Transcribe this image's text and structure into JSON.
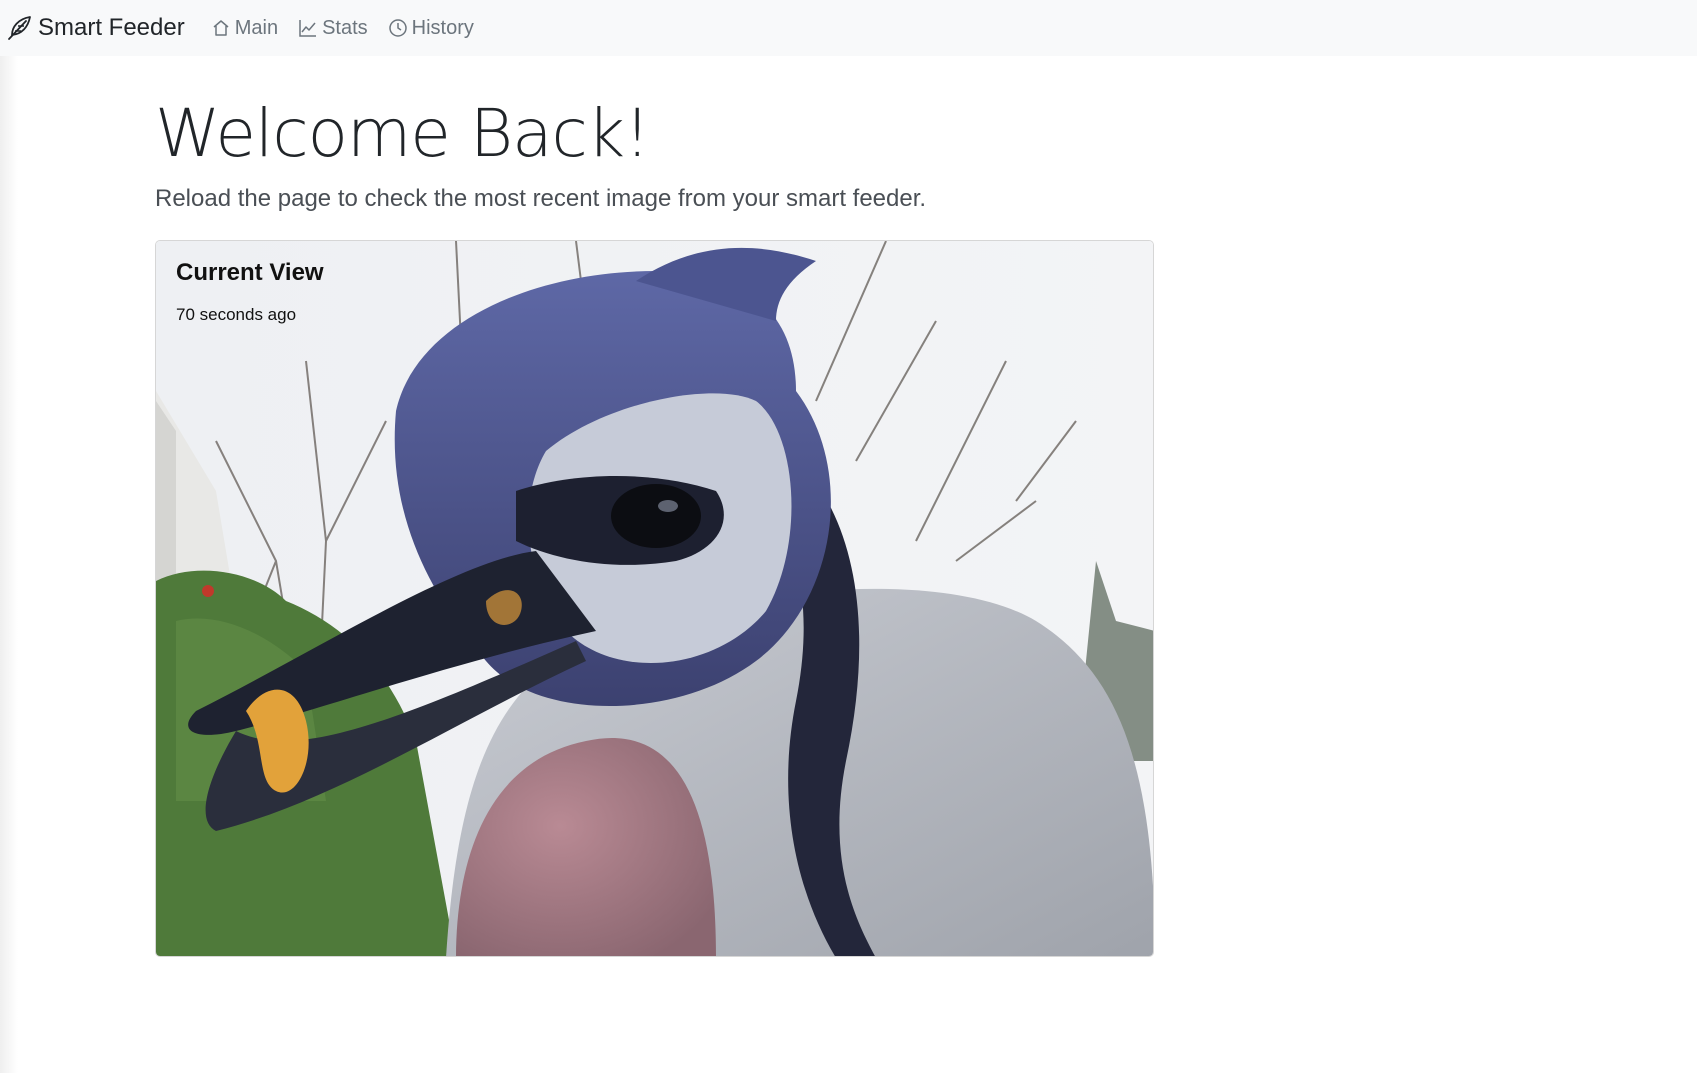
{
  "nav": {
    "brand": "Smart Feeder",
    "brand_icon": "feather-icon",
    "links": [
      {
        "label": "Main",
        "icon": "house-icon"
      },
      {
        "label": "Stats",
        "icon": "line-chart-icon"
      },
      {
        "label": "History",
        "icon": "clock-icon"
      }
    ]
  },
  "main": {
    "title": "Welcome Back!",
    "lead": "Reload the page to check the most recent image from your smart feeder."
  },
  "card": {
    "title": "Current View",
    "subtitle": "70 seconds ago",
    "image_subject": "close-up photo of a blue jay holding a peanut in its beak"
  }
}
